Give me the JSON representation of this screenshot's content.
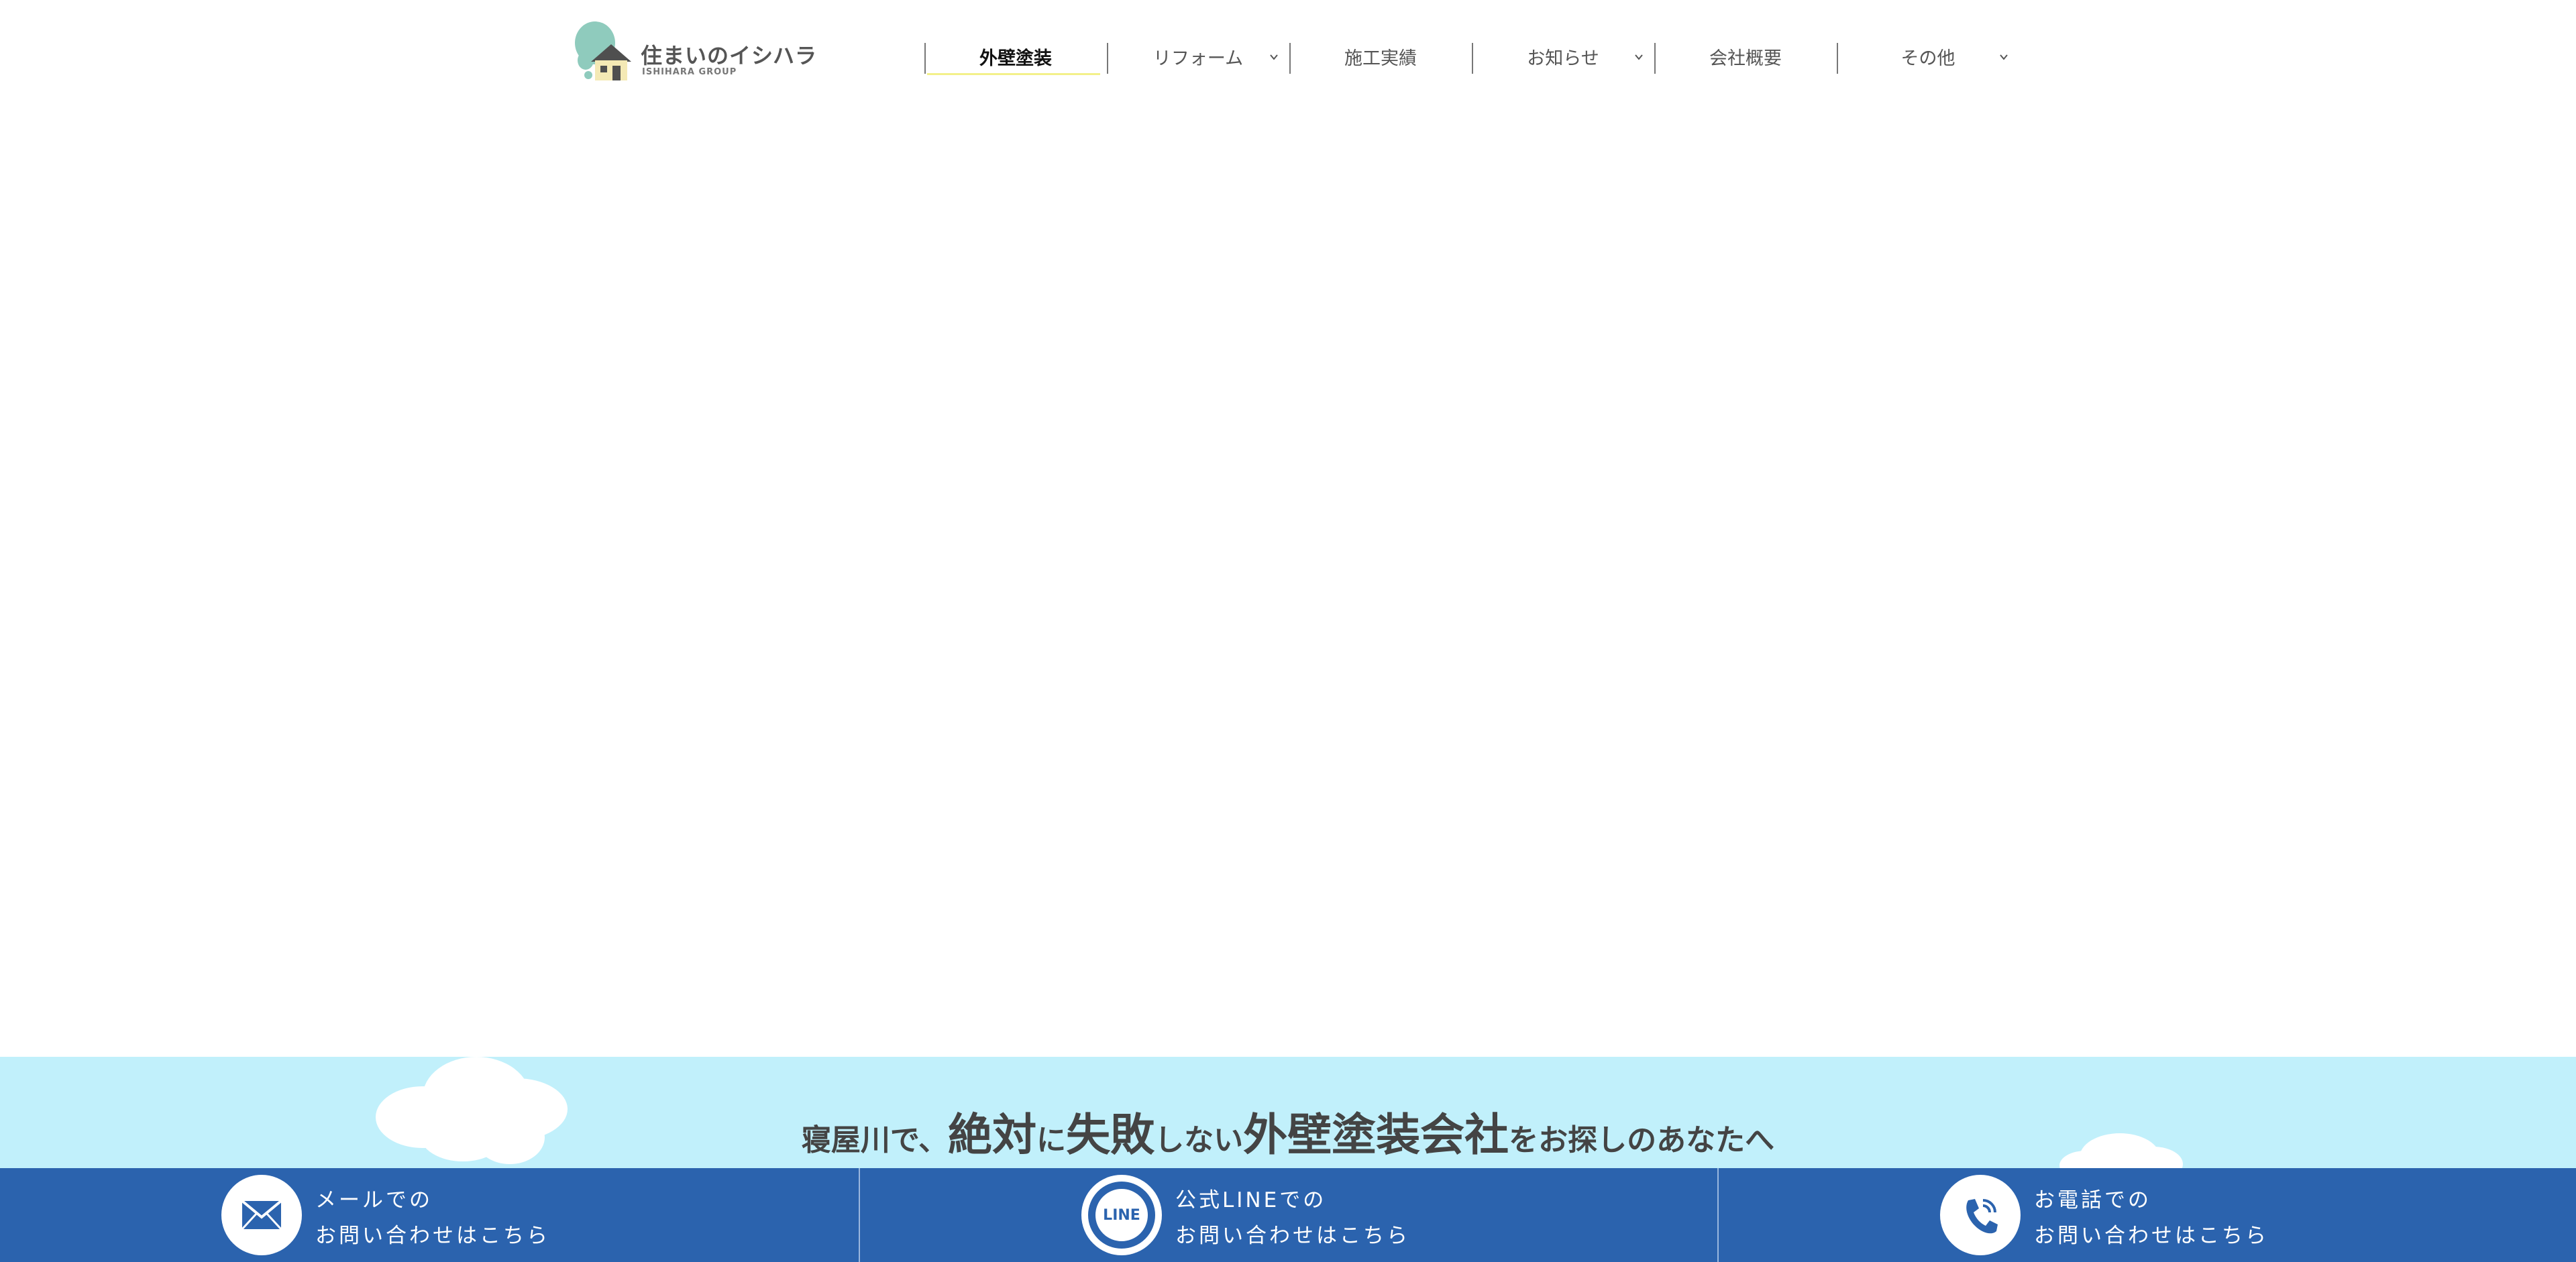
{
  "header": {
    "logo": {
      "title": "住まいのイシハラ",
      "subtitle": "ISHIHARA GROUP"
    },
    "nav": [
      {
        "label": "外壁塗装",
        "active": true,
        "has_dropdown": false
      },
      {
        "label": "リフォーム",
        "active": false,
        "has_dropdown": true
      },
      {
        "label": "施工実績",
        "active": false,
        "has_dropdown": false
      },
      {
        "label": "お知らせ",
        "active": false,
        "has_dropdown": true
      },
      {
        "label": "会社概要",
        "active": false,
        "has_dropdown": false
      },
      {
        "label": "その他",
        "active": false,
        "has_dropdown": true
      }
    ]
  },
  "headline": {
    "part1": "寝屋川で、",
    "part2": "絶対",
    "part3": "に",
    "part4": "失敗",
    "part5": "しない",
    "part6": "外壁塗装会社",
    "part7": "をお探しのあなたへ"
  },
  "contact": [
    {
      "icon": "mail-icon",
      "line1": "メールでの",
      "line2": "お問い合わせはこちら"
    },
    {
      "icon": "line-icon",
      "icon_text": "LINE",
      "line1": "公式LINEでの",
      "line2": "お問い合わせはこちら"
    },
    {
      "icon": "phone-icon",
      "line1": "お電話での",
      "line2": "お問い合わせはこちら"
    }
  ],
  "colors": {
    "contact_bar": "#2b63ae",
    "sky": "#c1f0fb",
    "active_underline": "#f3f08a",
    "logo_green": "#8fcbbd"
  }
}
